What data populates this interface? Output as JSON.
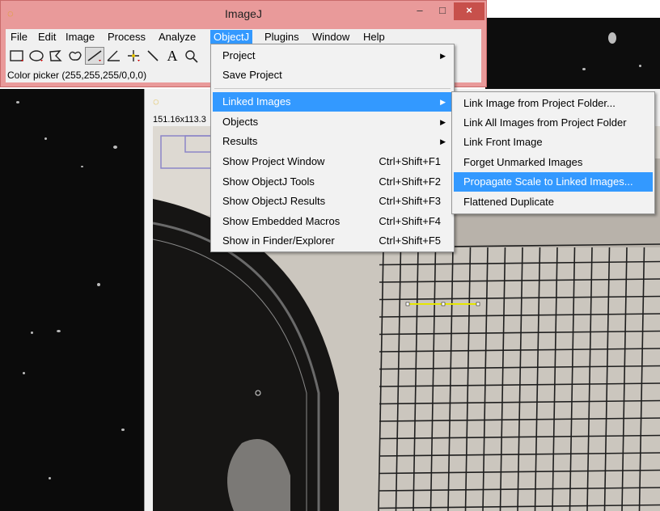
{
  "app": {
    "title": "ImageJ"
  },
  "window_buttons": {
    "minimize": "–",
    "maximize": "□",
    "close": "×"
  },
  "menubar": {
    "items": [
      "File",
      "Edit",
      "Image",
      "Process",
      "Analyze",
      "ObjectJ",
      "Plugins",
      "Window",
      "Help"
    ],
    "active": "ObjectJ"
  },
  "toolbar": {
    "tools": [
      "rectangle-tool",
      "oval-tool",
      "polygon-tool",
      "freehand-tool",
      "line-tool",
      "angle-tool",
      "point-tool",
      "wand-tool",
      "text-tool",
      "magnifier-tool"
    ],
    "selected": "line-tool",
    "text_tool_glyph": "A"
  },
  "status": {
    "text": "Color picker (255,255,255/0,0,0)"
  },
  "image_window": {
    "info": "151.16x113.3"
  },
  "objectj_menu": {
    "items": [
      {
        "label": "Project",
        "submenu": true
      },
      {
        "label": "Save Project"
      },
      {
        "label": "Linked Images",
        "submenu": true,
        "highlighted": true
      },
      {
        "label": "Objects",
        "submenu": true
      },
      {
        "label": "Results",
        "submenu": true
      },
      {
        "label": "Show Project Window",
        "shortcut": "Ctrl+Shift+F1"
      },
      {
        "label": "Show ObjectJ Tools",
        "shortcut": "Ctrl+Shift+F2"
      },
      {
        "label": "Show ObjectJ Results",
        "shortcut": "Ctrl+Shift+F3"
      },
      {
        "label": "Show Embedded Macros",
        "shortcut": "Ctrl+Shift+F4"
      },
      {
        "label": "Show in Finder/Explorer",
        "shortcut": "Ctrl+Shift+F5"
      }
    ]
  },
  "linked_images_submenu": {
    "items": [
      {
        "label": "Link Image from Project Folder..."
      },
      {
        "label": "Link All Images from Project Folder"
      },
      {
        "label": "Link Front Image"
      },
      {
        "label": "Forget Unmarked Images"
      },
      {
        "label": "Propagate Scale to Linked Images...",
        "highlighted": true
      },
      {
        "label": "Flattened Duplicate"
      }
    ]
  },
  "colors": {
    "titlebar": "#e99a9a",
    "highlight": "#3399ff",
    "measure_line": "#e6e600"
  }
}
